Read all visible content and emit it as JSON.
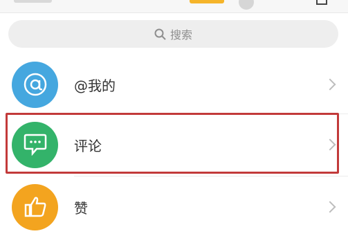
{
  "search": {
    "placeholder": "搜索",
    "icon": "search-icon"
  },
  "menu": [
    {
      "label": "@我的",
      "icon": "at-icon",
      "color": "#45a7df"
    },
    {
      "label": "评论",
      "icon": "comment-icon",
      "color": "#33b36a"
    },
    {
      "label": "赞",
      "icon": "thumbs-up-icon",
      "color": "#f3a41f"
    }
  ],
  "highlight": {
    "color": "#c23a3a"
  }
}
